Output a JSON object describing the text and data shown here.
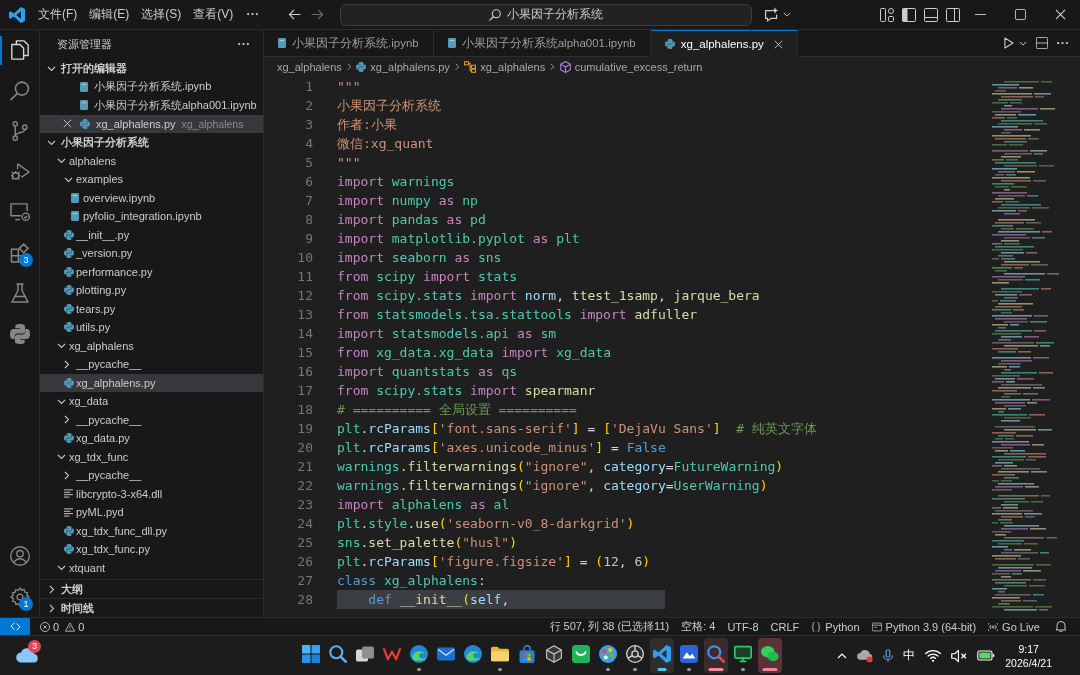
{
  "title_bar": {
    "menu": [
      "文件(F)",
      "编辑(E)",
      "选择(S)",
      "查看(V)"
    ],
    "search": "小果因子分析系统"
  },
  "activity_bar": {
    "items": [
      {
        "kind": "files",
        "selected": true
      },
      {
        "kind": "search",
        "selected": false
      },
      {
        "kind": "source-control",
        "selected": false
      },
      {
        "kind": "run-debug",
        "selected": false
      },
      {
        "kind": "remote",
        "selected": false
      },
      {
        "kind": "extensions",
        "selected": false,
        "badge": "3"
      },
      {
        "kind": "testing",
        "selected": false
      },
      {
        "kind": "python",
        "selected": false
      }
    ],
    "bottom": [
      {
        "kind": "account"
      },
      {
        "kind": "settings",
        "badge": "1"
      }
    ]
  },
  "sidebar": {
    "title": "资源管理器",
    "open_editors": {
      "title": "打开的编辑器",
      "expanded": true,
      "items": [
        {
          "label": "小果因子分析系统.ipynb",
          "kind": "notebook",
          "selected": false
        },
        {
          "label": "小果因子分析系统alpha001.ipynb",
          "kind": "notebook",
          "selected": false
        },
        {
          "label": "xg_alphalens.py",
          "kind": "python",
          "description": "xg_alphalens",
          "selected": true
        }
      ]
    },
    "folder": {
      "title": "小果因子分析系统",
      "expanded": true,
      "items": [
        {
          "label": "alphalens",
          "kind": "folder",
          "expanded": true,
          "selected": false,
          "children": [
            {
              "label": "examples",
              "kind": "folder",
              "expanded": true,
              "selected": false,
              "children": [
                {
                  "label": "overview.ipynb",
                  "kind": "notebook",
                  "selected": false
                },
                {
                  "label": "pyfolio_integration.ipynb",
                  "kind": "notebook",
                  "selected": false
                }
              ]
            },
            {
              "label": "__init__.py",
              "kind": "python",
              "selected": false
            },
            {
              "label": "_version.py",
              "kind": "python",
              "selected": false
            },
            {
              "label": "performance.py",
              "kind": "python",
              "selected": false
            },
            {
              "label": "plotting.py",
              "kind": "python",
              "selected": false
            },
            {
              "label": "tears.py",
              "kind": "python",
              "selected": false
            },
            {
              "label": "utils.py",
              "kind": "python",
              "selected": false
            }
          ]
        },
        {
          "label": "xg_alphalens",
          "kind": "folder",
          "expanded": true,
          "selected": false,
          "children": [
            {
              "label": "__pycache__",
              "kind": "folder",
              "expanded": false,
              "selected": false
            },
            {
              "label": "xg_alphalens.py",
              "kind": "python",
              "selected": true
            }
          ]
        },
        {
          "label": "xg_data",
          "kind": "folder",
          "expanded": true,
          "selected": false,
          "children": [
            {
              "label": "__pycache__",
              "kind": "folder",
              "expanded": false,
              "selected": false
            },
            {
              "label": "xg_data.py",
              "kind": "python",
              "selected": false
            }
          ]
        },
        {
          "label": "xg_tdx_func",
          "kind": "folder",
          "expanded": true,
          "selected": false,
          "children": [
            {
              "label": "__pycache__",
              "kind": "folder",
              "expanded": false,
              "selected": false
            },
            {
              "label": "libcrypto-3-x64.dll",
              "kind": "file",
              "selected": false
            },
            {
              "label": "pyML.pyd",
              "kind": "file",
              "selected": false
            },
            {
              "label": "xg_tdx_func_dll.py",
              "kind": "python",
              "selected": false
            },
            {
              "label": "xg_tdx_func.py",
              "kind": "python",
              "selected": false
            }
          ]
        },
        {
          "label": "xtquant",
          "kind": "folder",
          "expanded": true,
          "selected": false
        }
      ]
    },
    "panels": [
      {
        "title": "大纲",
        "expanded": false
      },
      {
        "title": "时间线",
        "expanded": false
      }
    ]
  },
  "editor": {
    "tabs": [
      {
        "label": "小果因子分析系统.ipynb",
        "kind": "notebook",
        "selected": false
      },
      {
        "label": "小果因子分析系统alpha001.ipynb",
        "kind": "notebook",
        "selected": false
      },
      {
        "label": "xg_alphalens.py",
        "kind": "python",
        "selected": true
      }
    ],
    "breadcrumbs": [
      {
        "label": "xg_alphalens",
        "kind": "folder"
      },
      {
        "label": "xg_alphalens.py",
        "kind": "python"
      },
      {
        "label": "xg_alphalens",
        "kind": "class"
      },
      {
        "label": "cumulative_excess_return",
        "kind": "method"
      }
    ],
    "lines": [
      {
        "number": "1",
        "selected": false,
        "tokens": [
          {
            "text": "\"\"\"",
            "kind": "string"
          }
        ]
      },
      {
        "number": "2",
        "selected": false,
        "tokens": [
          {
            "text": "小果因子分析系统",
            "kind": "string"
          }
        ]
      },
      {
        "number": "3",
        "selected": false,
        "tokens": [
          {
            "text": "作者:小果",
            "kind": "string"
          }
        ]
      },
      {
        "number": "4",
        "selected": false,
        "tokens": [
          {
            "text": "微信:xg_quant",
            "kind": "string"
          }
        ]
      },
      {
        "number": "5",
        "selected": false,
        "tokens": [
          {
            "text": "\"\"\"",
            "kind": "string"
          }
        ]
      },
      {
        "number": "6",
        "selected": false,
        "tokens": [
          {
            "text": "import ",
            "kind": "keyword"
          },
          {
            "text": "warnings",
            "kind": "module"
          }
        ]
      },
      {
        "number": "7",
        "selected": false,
        "tokens": [
          {
            "text": "import ",
            "kind": "keyword"
          },
          {
            "text": "numpy ",
            "kind": "module"
          },
          {
            "text": "as ",
            "kind": "keyword"
          },
          {
            "text": "np",
            "kind": "module"
          }
        ]
      },
      {
        "number": "8",
        "selected": false,
        "tokens": [
          {
            "text": "import ",
            "kind": "keyword"
          },
          {
            "text": "pandas ",
            "kind": "module"
          },
          {
            "text": "as ",
            "kind": "keyword"
          },
          {
            "text": "pd",
            "kind": "module"
          }
        ]
      },
      {
        "number": "9",
        "selected": false,
        "tokens": [
          {
            "text": "import ",
            "kind": "keyword"
          },
          {
            "text": "matplotlib.pyplot ",
            "kind": "module"
          },
          {
            "text": "as ",
            "kind": "keyword"
          },
          {
            "text": "plt",
            "kind": "module"
          }
        ]
      },
      {
        "number": "10",
        "selected": false,
        "tokens": [
          {
            "text": "import ",
            "kind": "keyword"
          },
          {
            "text": "seaborn ",
            "kind": "module"
          },
          {
            "text": "as ",
            "kind": "keyword"
          },
          {
            "text": "sns",
            "kind": "module"
          }
        ]
      },
      {
        "number": "11",
        "selected": false,
        "tokens": [
          {
            "text": "from ",
            "kind": "keyword"
          },
          {
            "text": "scipy ",
            "kind": "module"
          },
          {
            "text": "import ",
            "kind": "keyword"
          },
          {
            "text": "stats",
            "kind": "module"
          }
        ]
      },
      {
        "number": "12",
        "selected": false,
        "tokens": [
          {
            "text": "from ",
            "kind": "keyword"
          },
          {
            "text": "scipy.stats ",
            "kind": "module"
          },
          {
            "text": "import ",
            "kind": "keyword"
          },
          {
            "text": "norm",
            "kind": "variable"
          },
          {
            "text": ", ",
            "kind": "plain"
          },
          {
            "text": "ttest_1samp",
            "kind": "function"
          },
          {
            "text": ", ",
            "kind": "plain"
          },
          {
            "text": "jarque_bera",
            "kind": "function"
          }
        ]
      },
      {
        "number": "13",
        "selected": false,
        "tokens": [
          {
            "text": "from ",
            "kind": "keyword"
          },
          {
            "text": "statsmodels.tsa.stattools ",
            "kind": "module"
          },
          {
            "text": "import ",
            "kind": "keyword"
          },
          {
            "text": "adfuller",
            "kind": "function"
          }
        ]
      },
      {
        "number": "14",
        "selected": false,
        "tokens": [
          {
            "text": "import ",
            "kind": "keyword"
          },
          {
            "text": "statsmodels.api ",
            "kind": "module"
          },
          {
            "text": "as ",
            "kind": "keyword"
          },
          {
            "text": "sm",
            "kind": "module"
          }
        ]
      },
      {
        "number": "15",
        "selected": false,
        "tokens": [
          {
            "text": "from ",
            "kind": "keyword"
          },
          {
            "text": "xg_data.xg_data ",
            "kind": "module"
          },
          {
            "text": "import ",
            "kind": "keyword"
          },
          {
            "text": "xg_data",
            "kind": "module"
          }
        ]
      },
      {
        "number": "16",
        "selected": false,
        "tokens": [
          {
            "text": "import ",
            "kind": "keyword"
          },
          {
            "text": "quantstats ",
            "kind": "module"
          },
          {
            "text": "as ",
            "kind": "keyword"
          },
          {
            "text": "qs",
            "kind": "module"
          }
        ]
      },
      {
        "number": "17",
        "selected": false,
        "tokens": [
          {
            "text": "from ",
            "kind": "keyword"
          },
          {
            "text": "scipy.stats ",
            "kind": "module"
          },
          {
            "text": "import ",
            "kind": "keyword"
          },
          {
            "text": "spearmanr",
            "kind": "function"
          }
        ]
      },
      {
        "number": "18",
        "selected": false,
        "tokens": [
          {
            "text": "# ========== 全局设置 ==========",
            "kind": "comment"
          }
        ]
      },
      {
        "number": "19",
        "selected": false,
        "tokens": [
          {
            "text": "plt",
            "kind": "module"
          },
          {
            "text": ".",
            "kind": "plain"
          },
          {
            "text": "rcParams",
            "kind": "variable"
          },
          {
            "text": "[",
            "kind": "bracket"
          },
          {
            "text": "'font.sans-serif'",
            "kind": "string"
          },
          {
            "text": "]",
            "kind": "bracket"
          },
          {
            "text": " = ",
            "kind": "plain"
          },
          {
            "text": "[",
            "kind": "bracket"
          },
          {
            "text": "'DejaVu Sans'",
            "kind": "string"
          },
          {
            "text": "]",
            "kind": "bracket"
          },
          {
            "text": "  # 纯英文字体",
            "kind": "comment"
          }
        ]
      },
      {
        "number": "20",
        "selected": false,
        "tokens": [
          {
            "text": "plt",
            "kind": "module"
          },
          {
            "text": ".",
            "kind": "plain"
          },
          {
            "text": "rcParams",
            "kind": "variable"
          },
          {
            "text": "[",
            "kind": "bracket"
          },
          {
            "text": "'axes.unicode_minus'",
            "kind": "string"
          },
          {
            "text": "]",
            "kind": "bracket"
          },
          {
            "text": " = ",
            "kind": "plain"
          },
          {
            "text": "False",
            "kind": "storage"
          }
        ]
      },
      {
        "number": "21",
        "selected": false,
        "tokens": [
          {
            "text": "warnings",
            "kind": "module"
          },
          {
            "text": ".",
            "kind": "plain"
          },
          {
            "text": "filterwarnings",
            "kind": "function"
          },
          {
            "text": "(",
            "kind": "bracket"
          },
          {
            "text": "\"ignore\"",
            "kind": "string"
          },
          {
            "text": ", ",
            "kind": "plain"
          },
          {
            "text": "category",
            "kind": "variable"
          },
          {
            "text": "=",
            "kind": "plain"
          },
          {
            "text": "FutureWarning",
            "kind": "module"
          },
          {
            "text": ")",
            "kind": "bracket"
          }
        ]
      },
      {
        "number": "22",
        "selected": false,
        "tokens": [
          {
            "text": "warnings",
            "kind": "module"
          },
          {
            "text": ".",
            "kind": "plain"
          },
          {
            "text": "filterwarnings",
            "kind": "function"
          },
          {
            "text": "(",
            "kind": "bracket"
          },
          {
            "text": "\"ignore\"",
            "kind": "string"
          },
          {
            "text": ", ",
            "kind": "plain"
          },
          {
            "text": "category",
            "kind": "variable"
          },
          {
            "text": "=",
            "kind": "plain"
          },
          {
            "text": "UserWarning",
            "kind": "module"
          },
          {
            "text": ")",
            "kind": "bracket"
          }
        ]
      },
      {
        "number": "23",
        "selected": false,
        "tokens": [
          {
            "text": "import ",
            "kind": "keyword"
          },
          {
            "text": "alphalens ",
            "kind": "module"
          },
          {
            "text": "as ",
            "kind": "keyword"
          },
          {
            "text": "al",
            "kind": "module"
          }
        ]
      },
      {
        "number": "24",
        "selected": false,
        "tokens": [
          {
            "text": "plt",
            "kind": "module"
          },
          {
            "text": ".",
            "kind": "plain"
          },
          {
            "text": "style",
            "kind": "module"
          },
          {
            "text": ".",
            "kind": "plain"
          },
          {
            "text": "use",
            "kind": "function"
          },
          {
            "text": "(",
            "kind": "bracket"
          },
          {
            "text": "'seaborn-v0_8-darkgrid'",
            "kind": "string"
          },
          {
            "text": ")",
            "kind": "bracket"
          }
        ]
      },
      {
        "number": "25",
        "selected": false,
        "tokens": [
          {
            "text": "sns",
            "kind": "module"
          },
          {
            "text": ".",
            "kind": "plain"
          },
          {
            "text": "set_palette",
            "kind": "function"
          },
          {
            "text": "(",
            "kind": "bracket"
          },
          {
            "text": "\"husl\"",
            "kind": "string"
          },
          {
            "text": ")",
            "kind": "bracket"
          }
        ]
      },
      {
        "number": "26",
        "selected": false,
        "tokens": [
          {
            "text": "plt",
            "kind": "module"
          },
          {
            "text": ".",
            "kind": "plain"
          },
          {
            "text": "rcParams",
            "kind": "variable"
          },
          {
            "text": "[",
            "kind": "bracket"
          },
          {
            "text": "'figure.figsize'",
            "kind": "string"
          },
          {
            "text": "]",
            "kind": "bracket"
          },
          {
            "text": " = ",
            "kind": "plain"
          },
          {
            "text": "(",
            "kind": "bracket"
          },
          {
            "text": "12",
            "kind": "number"
          },
          {
            "text": ", ",
            "kind": "plain"
          },
          {
            "text": "6",
            "kind": "number"
          },
          {
            "text": ")",
            "kind": "bracket"
          }
        ]
      },
      {
        "number": "27",
        "selected": false,
        "tokens": [
          {
            "text": "class ",
            "kind": "storage"
          },
          {
            "text": "xg_alphalens",
            "kind": "module"
          },
          {
            "text": ":",
            "kind": "plain"
          }
        ]
      },
      {
        "number": "28",
        "selected": true,
        "tokens": [
          {
            "text": "    def ",
            "kind": "storage"
          },
          {
            "text": "__init__",
            "kind": "function"
          },
          {
            "text": "(",
            "kind": "bracket"
          },
          {
            "text": "self",
            "kind": "variable"
          },
          {
            "text": ",",
            "kind": "plain"
          }
        ]
      }
    ]
  },
  "status_bar": {
    "errors": "0",
    "warnings": "0",
    "items": [
      {
        "kind": "cursor",
        "text": "行 507, 列 38 (已选择11)"
      },
      {
        "kind": "indent",
        "text": "空格: 4"
      },
      {
        "kind": "encoding",
        "text": "UTF-8"
      },
      {
        "kind": "eol",
        "text": "CRLF"
      },
      {
        "kind": "language",
        "text": "Python"
      },
      {
        "kind": "interpreter",
        "text": "Python 3.9 (64-bit)"
      },
      {
        "kind": "live",
        "text": "Go Live"
      }
    ]
  },
  "taskbar": {
    "weather": {
      "badge": "3"
    },
    "apps": [
      {
        "kind": "start",
        "running": false,
        "active": false,
        "attention": false,
        "highlighted": false
      },
      {
        "kind": "search",
        "running": false,
        "active": false,
        "attention": false,
        "highlighted": false
      },
      {
        "kind": "task-view",
        "running": false,
        "active": false,
        "attention": false,
        "highlighted": false
      },
      {
        "kind": "zigzag",
        "running": false,
        "active": false,
        "attention": false,
        "highlighted": false
      },
      {
        "kind": "swirl",
        "running": true,
        "active": false,
        "attention": false,
        "highlighted": false
      },
      {
        "kind": "mail",
        "running": false,
        "active": false,
        "attention": false,
        "highlighted": false
      },
      {
        "kind": "swirl",
        "running": false,
        "active": false,
        "attention": false,
        "highlighted": false
      },
      {
        "kind": "folder",
        "running": true,
        "active": false,
        "attention": false,
        "highlighted": false
      },
      {
        "kind": "store",
        "running": false,
        "active": false,
        "attention": false,
        "highlighted": false
      },
      {
        "kind": "cube",
        "running": false,
        "active": false,
        "attention": false,
        "highlighted": false
      },
      {
        "kind": "bag",
        "running": false,
        "active": false,
        "attention": false,
        "highlighted": false
      },
      {
        "kind": "palette",
        "running": true,
        "active": false,
        "attention": false,
        "highlighted": false
      },
      {
        "kind": "ring",
        "running": true,
        "active": false,
        "attention": false,
        "highlighted": false
      },
      {
        "kind": "editor",
        "running": true,
        "active": true,
        "attention": false,
        "highlighted": false
      },
      {
        "kind": "tile",
        "running": true,
        "active": false,
        "attention": false,
        "highlighted": false
      },
      {
        "kind": "lens",
        "running": true,
        "active": false,
        "attention": true,
        "highlighted": false
      },
      {
        "kind": "monitor",
        "running": true,
        "active": false,
        "attention": false,
        "highlighted": false
      },
      {
        "kind": "chat",
        "running": true,
        "active": false,
        "attention": true,
        "highlighted": true
      }
    ],
    "tray": {
      "input_method": "中",
      "time": "9:17",
      "date": "2026/4/21"
    }
  }
}
